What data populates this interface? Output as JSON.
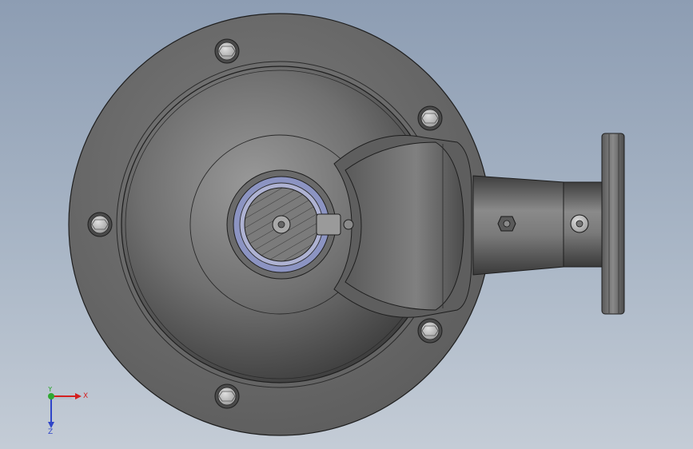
{
  "viewport": {
    "background_top": "#8d9db3",
    "background_bottom": "#c4ccd6"
  },
  "model": {
    "body_color": "#6e6e6e",
    "flange_color": "#6c6c6c",
    "edge_color": "#1e1e1e",
    "seal_ring_color": "#8c94c2",
    "shaft_color": "#7b7b7b"
  },
  "triad": {
    "x_label": "X",
    "y_label": "Y",
    "z_label": "Z",
    "x_color": "#d42020",
    "y_color": "#2fa832",
    "z_color": "#2f45c8"
  }
}
